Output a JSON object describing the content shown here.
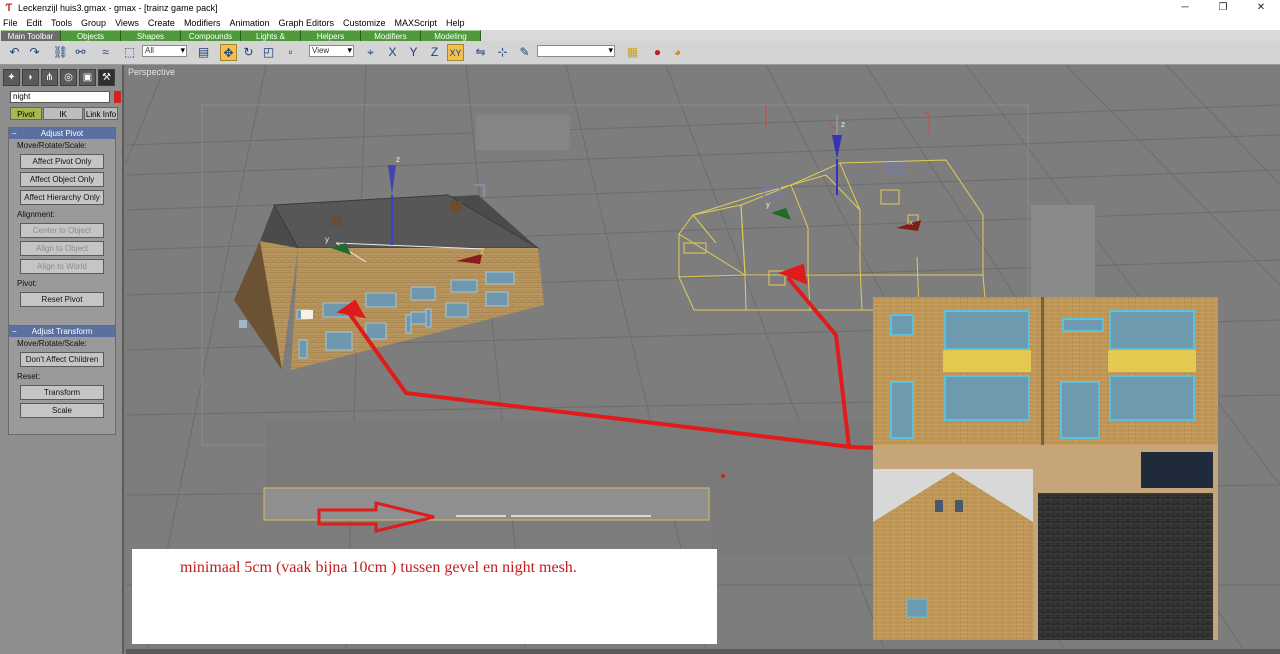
{
  "window": {
    "title": "Leckenzijl huis3.gmax - gmax - [trainz game pack]",
    "buttons": {
      "minimize": "─",
      "restore": "❐",
      "close": "✕"
    }
  },
  "menu": [
    "File",
    "Edit",
    "Tools",
    "Group",
    "Views",
    "Create",
    "Modifiers",
    "Animation",
    "Graph Editors",
    "Customize",
    "MAXScript",
    "Help"
  ],
  "tabs": [
    "Main Toolbar",
    "Objects",
    "Shapes",
    "Compounds",
    "Lights & Cameras",
    "Helpers",
    "Modifiers",
    "Modeling"
  ],
  "toolbar": {
    "selection_filter": "All",
    "ref_coord": "View",
    "named_selection": "",
    "axis_xy": "XY",
    "axis_x": "X",
    "axis_y": "Y",
    "axis_z": "Z"
  },
  "command_panel": {
    "object_name": "night",
    "subtabs": [
      "Pivot",
      "IK",
      "Link Info"
    ],
    "adjust_pivot": {
      "title": "Adjust Pivot",
      "move_rotate_scale_label": "Move/Rotate/Scale:",
      "affect_pivot_only": "Affect Pivot Only",
      "affect_object_only": "Affect Object Only",
      "affect_hierarchy_only": "Affect Hierarchy Only",
      "alignment_label": "Alignment:",
      "center_to_object": "Center to Object",
      "align_to_object": "Align to Object",
      "align_to_world": "Align to World",
      "pivot_label": "Pivot:",
      "reset_pivot": "Reset Pivot"
    },
    "adjust_transform": {
      "title": "Adjust Transform",
      "move_rotate_scale_label": "Move/Rotate/Scale:",
      "dont_affect_children": "Don't Affect Children",
      "reset_label": "Reset:",
      "transform": "Transform",
      "scale": "Scale"
    }
  },
  "viewport": {
    "label": "Perspective",
    "axis_labels": {
      "z1": "z",
      "y1": "y",
      "x1": "x",
      "z2": "z",
      "y2": "y",
      "x2": "x"
    }
  },
  "annotation": {
    "text": "minimaal 5cm (vaak bijna 10cm ) tussen gevel en night mesh.",
    "color": "#c21d1d"
  },
  "colors": {
    "arrow": "#e01b1b",
    "wireframe": "#e3cb57",
    "tab_green": "#4e9a3c",
    "panel_header": "#5b6fa0"
  }
}
